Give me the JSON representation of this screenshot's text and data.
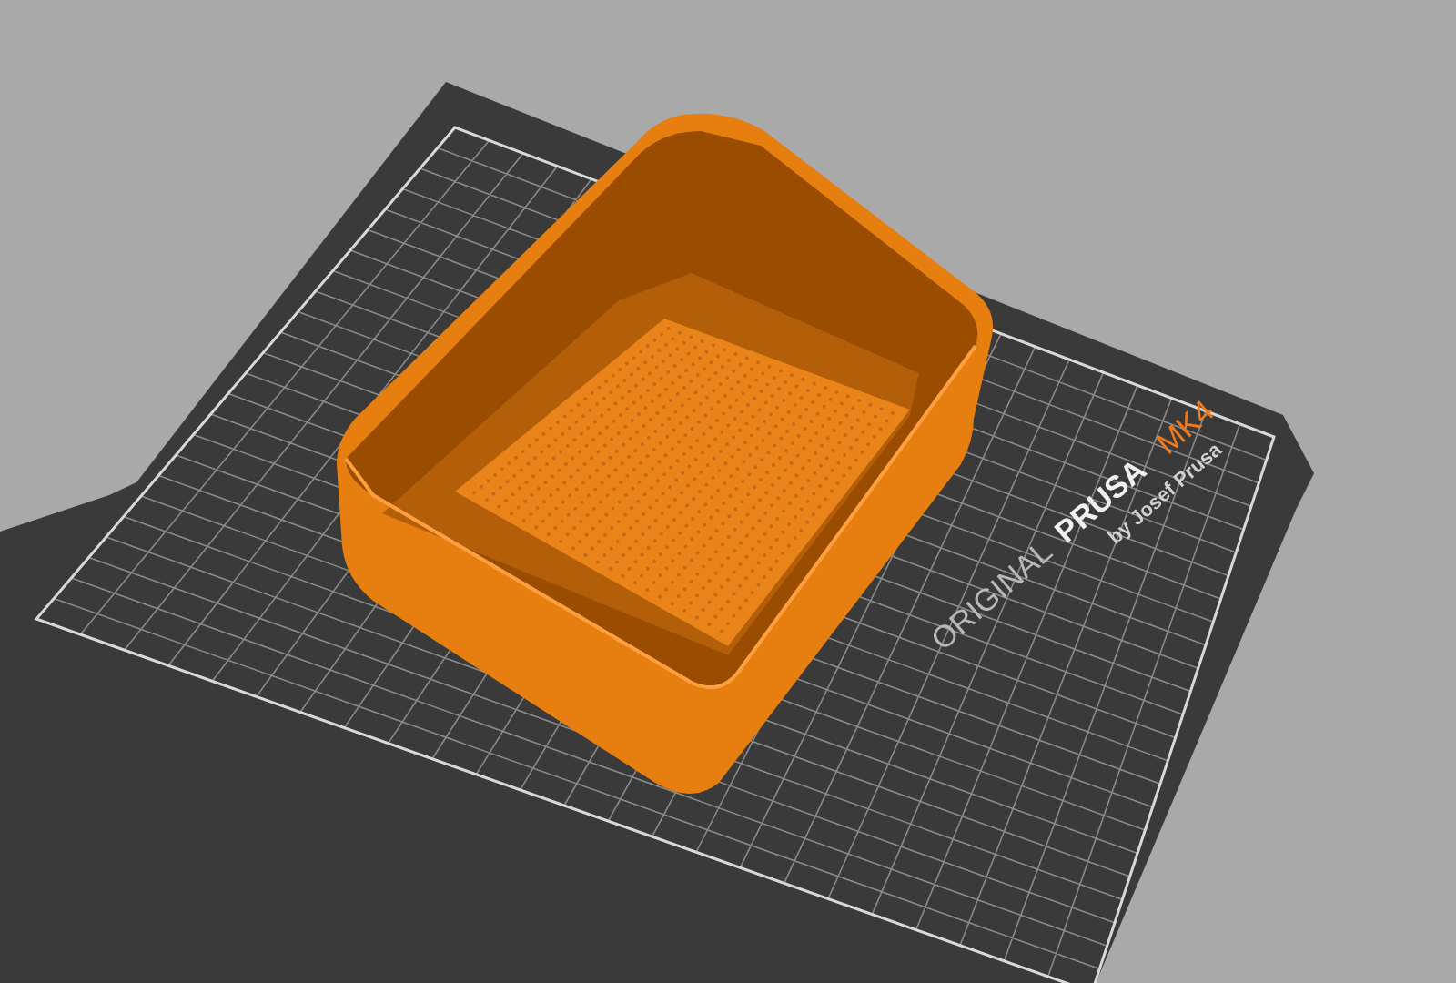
{
  "bed": {
    "brand": "ORIGINAL",
    "model": "PRUSA",
    "variant": "MK4",
    "maker": "by Josef Prusa"
  }
}
